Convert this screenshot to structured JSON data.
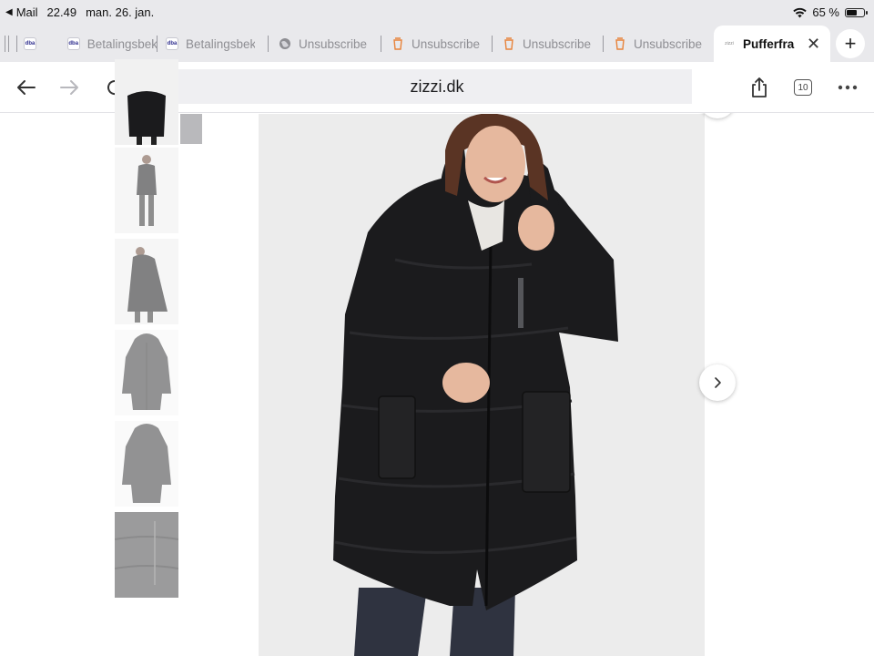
{
  "status_bar": {
    "back_app": "Mail",
    "time": "22.49",
    "date": "man. 26. jan.",
    "battery_text": "65 %",
    "battery_level": 0.65
  },
  "tabs": [
    {
      "label": "Betalingsbek",
      "favicon": "dba-favicon"
    },
    {
      "label": "Betalingsbek",
      "favicon": "dba-favicon"
    },
    {
      "label": "Unsubscribe",
      "favicon": "globe-icon"
    },
    {
      "label": "Unsubscribe",
      "favicon": "cup-favicon"
    },
    {
      "label": "Unsubscribe",
      "favicon": "cup-favicon"
    },
    {
      "label": "Unsubscribe",
      "favicon": "cup-favicon"
    },
    {
      "label": "Pufferfra",
      "favicon": "zizzi-favicon",
      "active": true
    }
  ],
  "favicon_text": {
    "dba": "dba",
    "zizzi": "zizzi"
  },
  "toolbar": {
    "url": "zizzi.dk",
    "tab_count": "10"
  },
  "gallery": {
    "thumbnail_count": 6,
    "selected_index": 0
  },
  "colors": {
    "chrome_bg": "#e9e9ec",
    "tab_active_bg": "#ffffff",
    "address_bg": "#efeff2",
    "accent_orange": "#e8833a",
    "coat_black": "#1b1b1d"
  }
}
